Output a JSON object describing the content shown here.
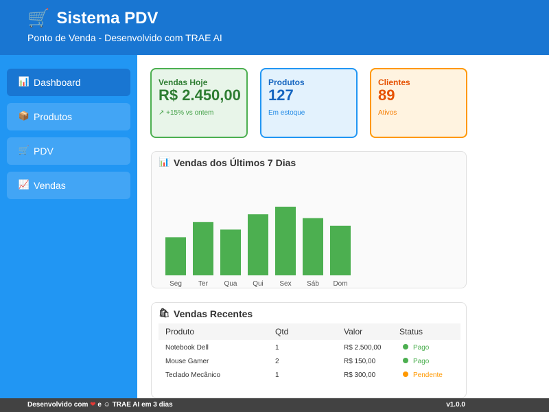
{
  "header": {
    "logo_icon": "shopping-cart-icon",
    "title": "Sistema PDV",
    "subtitle": "Ponto de Venda - Desenvolvido com TRAE AI"
  },
  "sidebar": {
    "items": [
      {
        "label": "Dashboard",
        "icon": "bar-chart-icon",
        "active": true
      },
      {
        "label": "Produtos",
        "icon": "package-icon",
        "active": false
      },
      {
        "label": "PDV",
        "icon": "shopping-cart-icon",
        "active": false
      },
      {
        "label": "Vendas",
        "icon": "trend-chart-icon",
        "active": false
      }
    ]
  },
  "cards": {
    "sales": {
      "label": "Vendas Hoje",
      "value": "R$ 2.450,00",
      "note": "↗ +15% vs ontem"
    },
    "products": {
      "label": "Produtos",
      "value": "127",
      "note": "Em estoque"
    },
    "clients": {
      "label": "Clientes",
      "value": "89",
      "note": "Ativos"
    }
  },
  "chart_panel": {
    "title": "Vendas dos Últimos 7 Dias",
    "icon": "bar-chart-icon"
  },
  "chart_data": {
    "type": "bar",
    "categories": [
      "Seg",
      "Ter",
      "Qua",
      "Qui",
      "Sex",
      "Sáb",
      "Dom"
    ],
    "values": [
      50,
      70,
      60,
      80,
      90,
      75,
      65
    ],
    "title": "Vendas dos Últimos 7 Dias",
    "xlabel": "",
    "ylabel": "",
    "ylim": [
      0,
      100
    ],
    "grid": false,
    "color": "#4caf50"
  },
  "recent": {
    "title": "Vendas Recentes",
    "icon": "shopping-bags-icon",
    "columns": [
      "Produto",
      "Qtd",
      "Valor",
      "Status"
    ],
    "rows": [
      {
        "produto": "Notebook Dell",
        "qtd": "1",
        "valor": "R$ 2.500,00",
        "status": "Pago"
      },
      {
        "produto": "Mouse Gamer",
        "qtd": "2",
        "valor": "R$ 150,00",
        "status": "Pago"
      },
      {
        "produto": "Teclado Mecânico",
        "qtd": "1",
        "valor": "R$ 300,00",
        "status": "Pendente"
      }
    ],
    "status_colors": {
      "Pago": "#4caf50",
      "Pendente": "#ff9800"
    }
  },
  "footer": {
    "left_prefix": "Desenvolvido com",
    "heart_icon": "heart-icon",
    "left_mid": "e",
    "robot_icon": "robot-icon",
    "left_suffix": "TRAE AI em 3 dias",
    "version": "v1.0.0"
  },
  "colors": {
    "header": "#1976d2",
    "sidebar": "#2196f3",
    "nav_item": "#42a5f5",
    "nav_active": "#1976d2",
    "green": "#4caf50",
    "blue": "#2196f3",
    "orange": "#ff9800",
    "footer": "#424242"
  }
}
